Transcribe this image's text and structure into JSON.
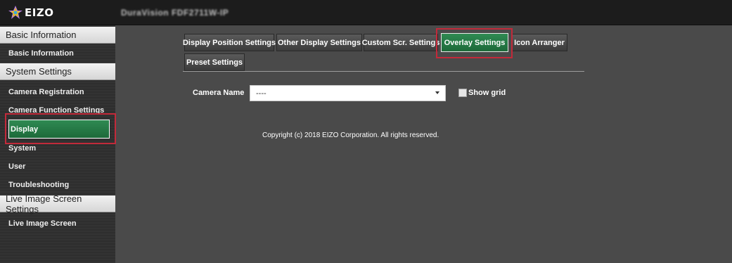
{
  "header": {
    "logo_text": "EIZO",
    "product_name": "DuraVision FDF2711W-IP"
  },
  "sidebar": {
    "sections": [
      {
        "title": "Basic Information",
        "items": [
          "Basic Information"
        ]
      },
      {
        "title": "System Settings",
        "items": [
          "Camera Registration",
          "Camera Function Settings",
          "Display",
          "System",
          "User",
          "Troubleshooting"
        ]
      },
      {
        "title": "Live Image Screen Settings",
        "items": [
          "Live Image Screen"
        ]
      }
    ],
    "active_item": "Display"
  },
  "tabs": {
    "items": [
      "Display Position Settings",
      "Other Display Settings",
      "Custom Scr. Settings",
      "Overlay Settings",
      "Icon Arranger",
      "Preset Settings"
    ],
    "active": "Overlay Settings"
  },
  "form": {
    "camera_name_label": "Camera Name",
    "camera_name_value": "----",
    "show_grid_label": "Show grid",
    "show_grid_checked": false
  },
  "footer": {
    "copyright": "Copyright (c) 2018 EIZO Corporation. All rights reserved."
  },
  "colors": {
    "accent_green": "#1d6a3a",
    "highlight_red": "#c22a3a",
    "background": "#4a4a4a",
    "header_bg": "#1c1c1c"
  },
  "icons": {
    "logo": "eizo-logo-icon",
    "dropdown": "chevron-down-icon"
  }
}
